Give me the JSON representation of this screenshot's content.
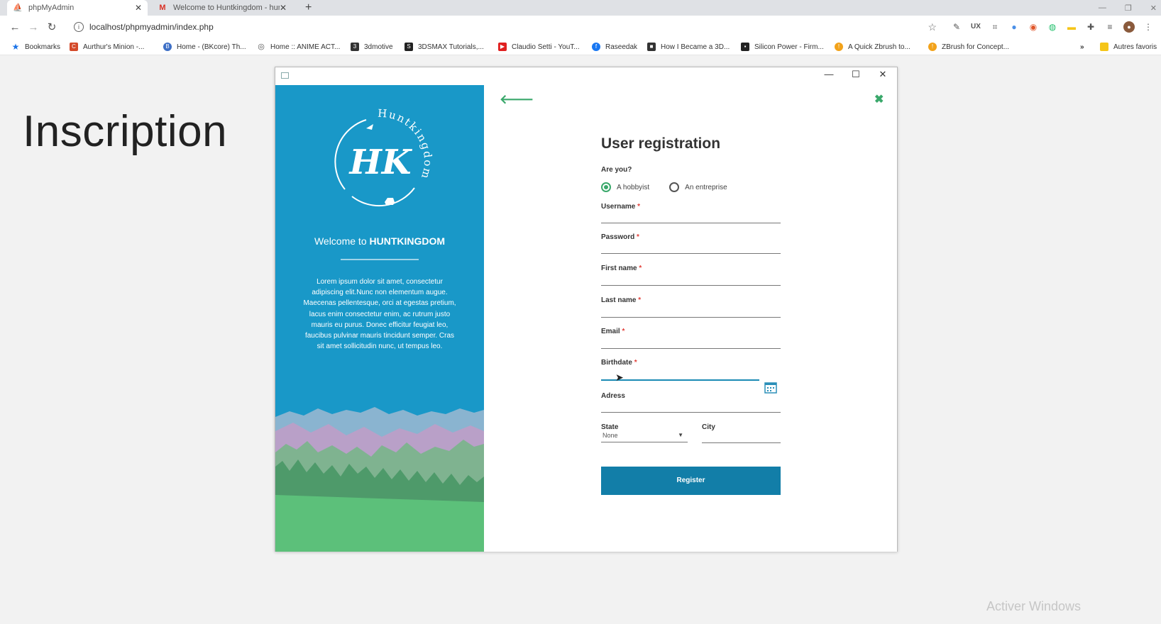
{
  "browser": {
    "tabs": [
      {
        "label": "phpMyAdmin",
        "icon": "php-icon"
      },
      {
        "label": "Welcome to Huntkingdom - hun",
        "icon": "gmail-icon"
      }
    ],
    "new_tab": "+",
    "url": "localhost/phpmyadmin/index.php",
    "bookmarks": [
      {
        "label": "Bookmarks",
        "color": "#1a73e8"
      },
      {
        "label": "Aurthur's Minion -...",
        "color": "#d44a2a"
      },
      {
        "label": "Home - (BKcore) Th...",
        "color": "#3d6fc6"
      },
      {
        "label": "Home :: ANIME ACT...",
        "color": "#555555"
      },
      {
        "label": "3dmotive",
        "color": "#333333"
      },
      {
        "label": "3DSMAX Tutorials,...",
        "color": "#222222"
      },
      {
        "label": "Claudio Setti - YouT...",
        "color": "#e02020"
      },
      {
        "label": "Raseedak",
        "color": "#1877f2"
      },
      {
        "label": "How I Became a 3D...",
        "color": "#333333"
      },
      {
        "label": "Silicon Power - Firm...",
        "color": "#222222"
      },
      {
        "label": "A Quick Zbrush to...",
        "color": "#f2a21a"
      },
      {
        "label": "ZBrush for Concept...",
        "color": "#f2a21a"
      }
    ],
    "more": "»",
    "other_bookmarks": "Autres favoris"
  },
  "page": {
    "title": "Inscription",
    "watermark": "Activer Windows"
  },
  "app": {
    "welcome_prefix": "Welcome to ",
    "welcome_brand": "HUNTKINGDOM",
    "logo_text": "HK",
    "logo_ring_text": "Huntkingdom",
    "lorem": "Lorem ipsum dolor sit amet, consectetur adipiscing elit.Nunc non elementum augue. Maecenas pellentesque, orci at egestas pretium, lacus enim consectetur enim, ac rutrum justo mauris eu purus. Donec efficitur feugiat leo, faucibus pulvinar mauris tincidunt semper. Cras sit amet sollicitudin nunc, ut tempus leo.",
    "form": {
      "title": "User registration",
      "are_you": "Are you?",
      "radio_hobbyist": "A hobbyist",
      "radio_entreprise": "An entreprise",
      "username": "Username",
      "password": "Password",
      "first_name": "First name",
      "last_name": "Last name",
      "email": "Email",
      "birthdate": "Birthdate",
      "adress": "Adress",
      "state": "State",
      "state_value": "None",
      "city": "City",
      "required_mark": "*",
      "register": "Register"
    },
    "colors": {
      "panel": "#1998c8",
      "accent": "#3aa86b",
      "button": "#127ea8"
    }
  }
}
